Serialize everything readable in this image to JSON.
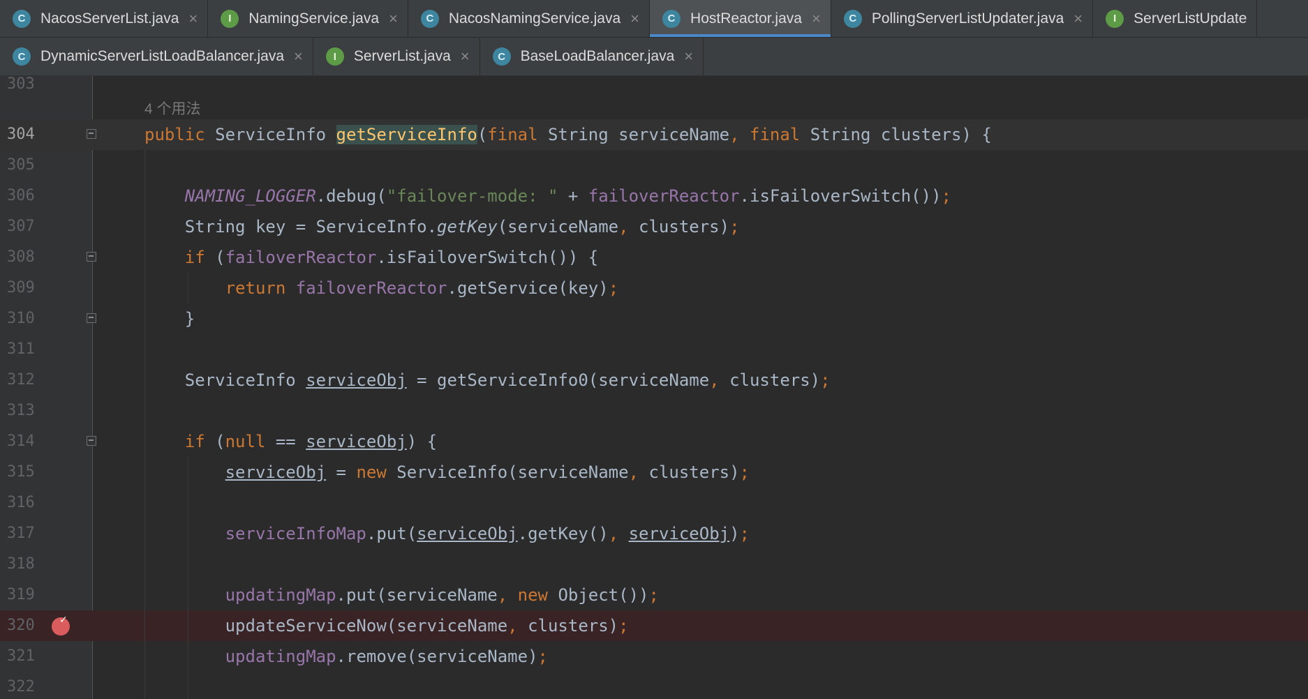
{
  "tabs_row1": [
    {
      "label": "NacosServerList.java",
      "icon": "class-icon",
      "letter": "C",
      "active": false
    },
    {
      "label": "NamingService.java",
      "icon": "interface-icon",
      "letter": "I",
      "active": false
    },
    {
      "label": "NacosNamingService.java",
      "icon": "class-icon",
      "letter": "C",
      "active": false
    },
    {
      "label": "HostReactor.java",
      "icon": "class-icon",
      "letter": "C",
      "active": true
    },
    {
      "label": "PollingServerListUpdater.java",
      "icon": "class-icon",
      "letter": "C",
      "active": false
    },
    {
      "label": "ServerListUpdate",
      "icon": "interface-icon",
      "letter": "I",
      "active": false
    }
  ],
  "tabs_row2": [
    {
      "label": "DynamicServerListLoadBalancer.java",
      "icon": "class-icon",
      "letter": "C",
      "active": false
    },
    {
      "label": "ServerList.java",
      "icon": "interface-icon",
      "letter": "I",
      "active": false
    },
    {
      "label": "BaseLoadBalancer.java",
      "icon": "class-icon",
      "letter": "C",
      "active": false
    }
  ],
  "close_glyph": "×",
  "usage_hint": "4 个用法",
  "breakpoint_line": "320",
  "colors": {
    "keyword": "#cc7832",
    "method": "#ffc66d",
    "string": "#6a8759",
    "field": "#9876aa",
    "default": "#a9b7c6",
    "breakpoint": "#db5c5c",
    "active_tab_underline": "#4a88c7"
  },
  "code_lines": [
    {
      "num": "303",
      "tokens": []
    },
    {
      "num": "304",
      "tokens": [
        [
          "public ",
          "kw"
        ],
        [
          "ServiceInfo ",
          ""
        ],
        [
          "getServiceInfo",
          "fnhl"
        ],
        [
          "(",
          ""
        ],
        [
          "final ",
          "kw"
        ],
        [
          "String serviceName",
          ""
        ],
        [
          ", ",
          "kw"
        ],
        [
          "final ",
          "kw"
        ],
        [
          "String clusters) {",
          ""
        ]
      ]
    },
    {
      "num": "305",
      "tokens": []
    },
    {
      "num": "306",
      "tokens": [
        [
          "    ",
          ""
        ],
        [
          "NAMING_LOGGER",
          "cst"
        ],
        [
          ".debug(",
          ""
        ],
        [
          "\"failover-mode: \"",
          "str"
        ],
        [
          " + ",
          ""
        ],
        [
          "failoverReactor",
          "fld"
        ],
        [
          ".isFailoverSwitch())",
          ""
        ],
        [
          ";",
          "kw"
        ]
      ]
    },
    {
      "num": "307",
      "tokens": [
        [
          "    String key = ServiceInfo.",
          ""
        ],
        [
          "getKey",
          "st"
        ],
        [
          "(serviceName",
          ""
        ],
        [
          ", ",
          "kw"
        ],
        [
          "clusters)",
          ""
        ],
        [
          ";",
          "kw"
        ]
      ]
    },
    {
      "num": "308",
      "tokens": [
        [
          "    ",
          ""
        ],
        [
          "if ",
          "kw"
        ],
        [
          "(",
          ""
        ],
        [
          "failoverReactor",
          "fld"
        ],
        [
          ".isFailoverSwitch()) {",
          ""
        ]
      ]
    },
    {
      "num": "309",
      "tokens": [
        [
          "        ",
          ""
        ],
        [
          "return ",
          "kw"
        ],
        [
          "failoverReactor",
          "fld"
        ],
        [
          ".getService(key)",
          ""
        ],
        [
          ";",
          "kw"
        ]
      ]
    },
    {
      "num": "310",
      "tokens": [
        [
          "    }",
          ""
        ]
      ]
    },
    {
      "num": "311",
      "tokens": []
    },
    {
      "num": "312",
      "tokens": [
        [
          "    ServiceInfo ",
          ""
        ],
        [
          "serviceObj",
          "u"
        ],
        [
          " = getServiceInfo0(serviceName",
          ""
        ],
        [
          ", ",
          "kw"
        ],
        [
          "clusters)",
          ""
        ],
        [
          ";",
          "kw"
        ]
      ]
    },
    {
      "num": "313",
      "tokens": []
    },
    {
      "num": "314",
      "tokens": [
        [
          "    ",
          ""
        ],
        [
          "if ",
          "kw"
        ],
        [
          "(",
          ""
        ],
        [
          "null ",
          "kw"
        ],
        [
          "== ",
          ""
        ],
        [
          "serviceObj",
          "u"
        ],
        [
          ") {",
          ""
        ]
      ]
    },
    {
      "num": "315",
      "tokens": [
        [
          "        ",
          ""
        ],
        [
          "serviceObj",
          "u"
        ],
        [
          " = ",
          ""
        ],
        [
          "new ",
          "kw"
        ],
        [
          "ServiceInfo(serviceName",
          ""
        ],
        [
          ", ",
          "kw"
        ],
        [
          "clusters)",
          ""
        ],
        [
          ";",
          "kw"
        ]
      ]
    },
    {
      "num": "316",
      "tokens": []
    },
    {
      "num": "317",
      "tokens": [
        [
          "        ",
          ""
        ],
        [
          "serviceInfoMap",
          "fld"
        ],
        [
          ".put(",
          ""
        ],
        [
          "serviceObj",
          "u"
        ],
        [
          ".getKey()",
          ""
        ],
        [
          ", ",
          "kw"
        ],
        [
          "serviceObj",
          "u"
        ],
        [
          ")",
          ""
        ],
        [
          ";",
          "kw"
        ]
      ]
    },
    {
      "num": "318",
      "tokens": []
    },
    {
      "num": "319",
      "tokens": [
        [
          "        ",
          ""
        ],
        [
          "updatingMap",
          "fld"
        ],
        [
          ".put(serviceName",
          ""
        ],
        [
          ", ",
          "kw"
        ],
        [
          "new ",
          "kw"
        ],
        [
          "Object())",
          ""
        ],
        [
          ";",
          "kw"
        ]
      ]
    },
    {
      "num": "320",
      "tokens": [
        [
          "        updateServiceNow(serviceName",
          ""
        ],
        [
          ", ",
          "kw"
        ],
        [
          "clusters)",
          ""
        ],
        [
          ";",
          "kw"
        ]
      ]
    },
    {
      "num": "321",
      "tokens": [
        [
          "        ",
          ""
        ],
        [
          "updatingMap",
          "fld"
        ],
        [
          ".remove(serviceName)",
          ""
        ],
        [
          ";",
          "kw"
        ]
      ]
    },
    {
      "num": "322",
      "tokens": []
    }
  ]
}
